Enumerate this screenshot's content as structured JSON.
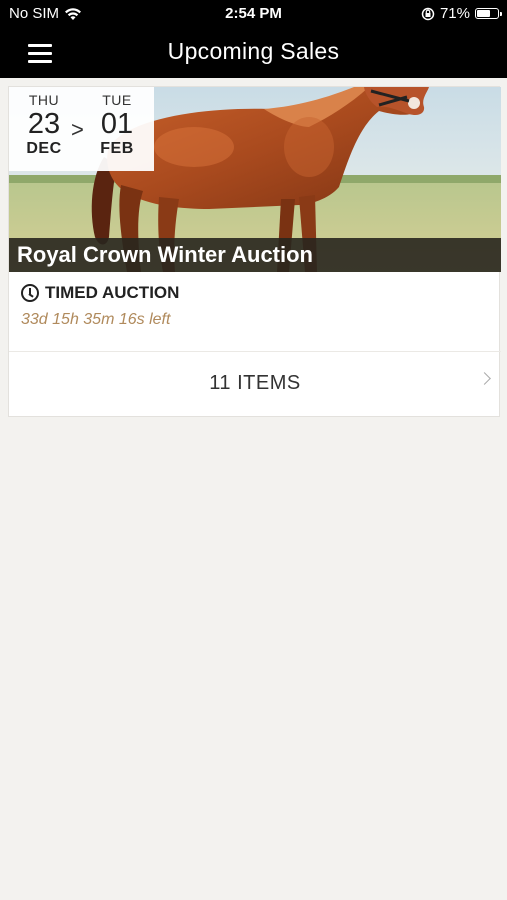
{
  "status_bar": {
    "carrier": "No SIM",
    "time": "2:54 PM",
    "battery_pct": "71%",
    "battery_level": 0.71
  },
  "nav": {
    "title": "Upcoming Sales"
  },
  "sale": {
    "start": {
      "dow": "THU",
      "day": "23",
      "month": "DEC"
    },
    "separator": ">",
    "end": {
      "dow": "TUE",
      "day": "01",
      "month": "FEB"
    },
    "title": "Royal Crown Winter Auction",
    "auction_type": "TIMED AUCTION",
    "time_left": "33d 15h 35m 16s left",
    "items_label": "11 ITEMS"
  },
  "colors": {
    "header_bg": "#000000",
    "page_bg": "#f3f2ef",
    "accent_time": "#b08a5c",
    "title_band": "#28261e"
  }
}
